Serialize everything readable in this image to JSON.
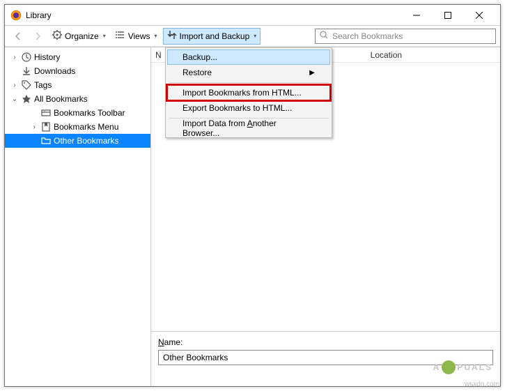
{
  "window": {
    "title": "Library"
  },
  "toolbar": {
    "organize": "Organize",
    "views": "Views",
    "import_backup": "Import and Backup",
    "search_placeholder": "Search Bookmarks"
  },
  "columns": {
    "name": "N",
    "location": "Location"
  },
  "sidebar": {
    "history": "History",
    "downloads": "Downloads",
    "tags": "Tags",
    "all_bookmarks": "All Bookmarks",
    "bookmarks_toolbar": "Bookmarks Toolbar",
    "bookmarks_menu": "Bookmarks Menu",
    "other_bookmarks": "Other Bookmarks"
  },
  "menu": {
    "backup": "Backup...",
    "restore": "Restore",
    "import_html_pre": "Import Bookmarks from HTML...",
    "export_html_pre": "Export Bookmarks to HTML...",
    "import_other_pre": "Import Data from ",
    "import_other_u": "A",
    "import_other_post": "nother Browser..."
  },
  "details": {
    "name_label_u": "N",
    "name_label_post": "ame:",
    "name_value": "Other Bookmarks"
  },
  "watermark": {
    "pre": "A",
    "post": "PUALS"
  },
  "credit": "wsxdn.com"
}
